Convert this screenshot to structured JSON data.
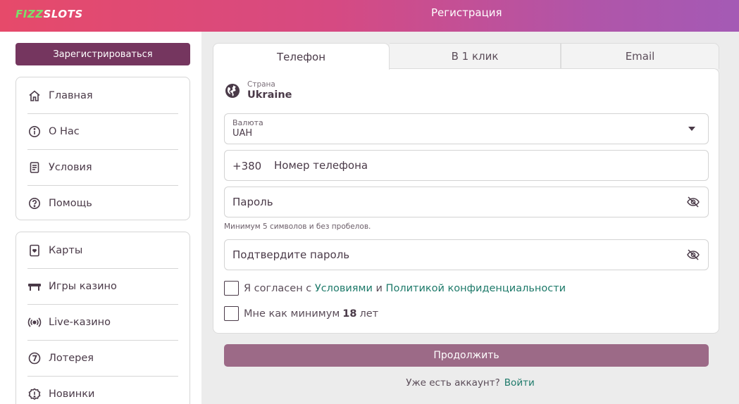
{
  "header": {
    "logo_fizz": "FIZZ",
    "logo_slots": "SLOTS",
    "title": "Регистрация",
    "colors": {
      "gradient_start": "#e64a6a",
      "gradient_end": "#a45ab5"
    }
  },
  "sidebar": {
    "register_label": "Зарегистрироваться",
    "main_items": [
      {
        "label": "Главная",
        "icon": "home-icon"
      },
      {
        "label": "О Нас",
        "icon": "info-icon"
      },
      {
        "label": "Условия",
        "icon": "document-icon"
      },
      {
        "label": "Помощь",
        "icon": "help-icon"
      }
    ],
    "game_items": [
      {
        "label": "Карты",
        "icon": "cards-icon"
      },
      {
        "label": "Игры казино",
        "icon": "table-icon"
      },
      {
        "label": "Live-казино",
        "icon": "live-icon"
      },
      {
        "label": "Лотерея",
        "icon": "lottery-icon"
      },
      {
        "label": "Новинки",
        "icon": "new-icon"
      }
    ]
  },
  "tabs": [
    {
      "label": "Телефон",
      "active": true
    },
    {
      "label": "В 1 клик",
      "active": false
    },
    {
      "label": "Email",
      "active": false
    }
  ],
  "form": {
    "country_label": "Страна",
    "country_value": "Ukraine",
    "currency_label": "Валюта",
    "currency_value": "UAH",
    "phone_prefix": "+380",
    "phone_placeholder": "Номер телефона",
    "password_placeholder": "Пароль",
    "password_hint": "Минимум 5 символов и без пробелов.",
    "confirm_placeholder": "Подтвердите пароль",
    "agree_prefix": "Я согласен с",
    "agree_terms_link": "Условиями",
    "agree_and": "и",
    "agree_policy_link": "Политикой конфиденциальности",
    "age_prefix": "Мне как минимум",
    "age_number": "18",
    "age_suffix": "лет"
  },
  "actions": {
    "continue_label": "Продолжить",
    "have_account": "Уже есть аккаунт?",
    "login_link": "Войти",
    "colors": {
      "continue_bg": "#9c6a87",
      "register_bg": "#75365f",
      "link": "#1e7a6a"
    }
  }
}
